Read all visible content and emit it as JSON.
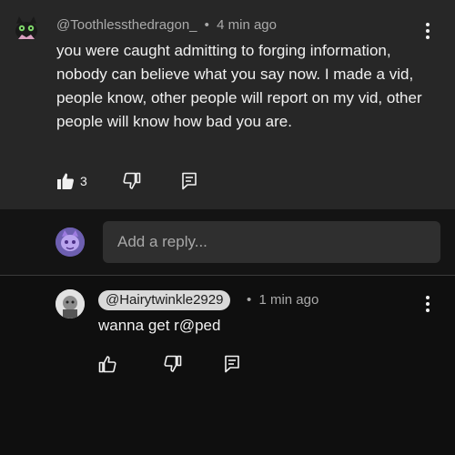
{
  "comment": {
    "handle": "@Toothlessthedragon_",
    "separator": "•",
    "time": "4 min ago",
    "text": "you were caught admitting to forging information, nobody can believe what you say now. I made a vid, people know, other people will report on my vid, other people will know how bad you are.",
    "like_count": "3",
    "icons": {
      "like": "thumbs-up-filled-icon",
      "dislike": "thumbs-down-icon",
      "reply": "reply-icon",
      "menu": "more-vert-icon"
    }
  },
  "reply_box": {
    "placeholder": "Add a reply..."
  },
  "reply": {
    "handle": "@Hairytwinkle2929",
    "separator": "•",
    "time": "1 min ago",
    "text": "wanna get r@ped",
    "icons": {
      "like": "thumbs-up-icon",
      "dislike": "thumbs-down-icon",
      "reply": "reply-icon",
      "menu": "more-vert-icon"
    }
  },
  "colors": {
    "comment_background": "#272727",
    "page_background": "#0f0f0f",
    "input_background": "#2f2f2f",
    "handle_pill": "#d9d9d9",
    "text_primary": "#f1f1f1",
    "text_secondary": "#aaaaaa"
  }
}
